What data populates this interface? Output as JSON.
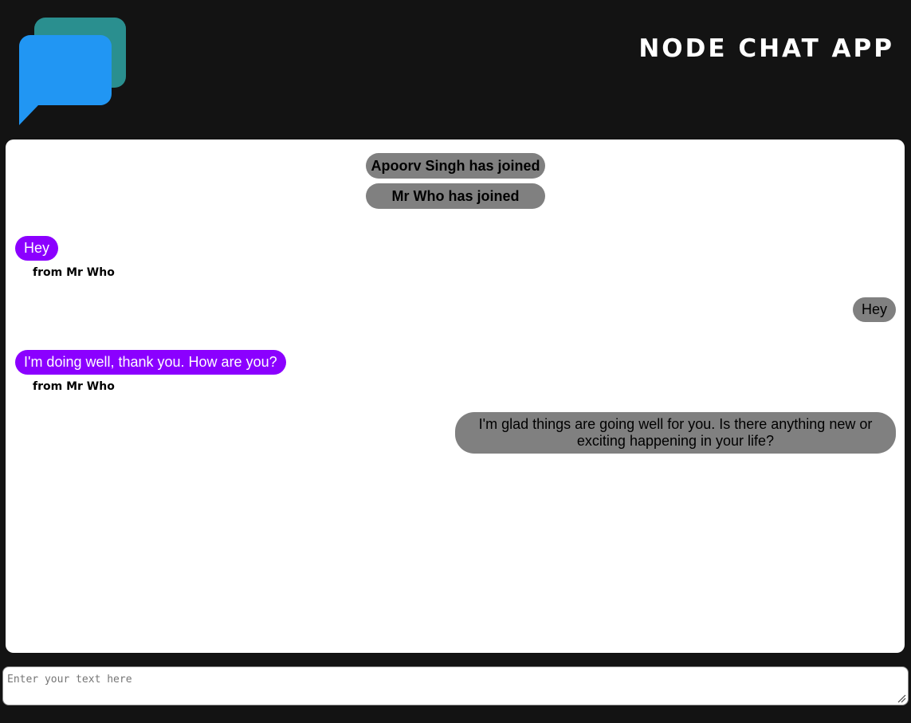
{
  "header": {
    "title": "NODE CHAT APP",
    "logo_icon": "chat-bubbles-icon",
    "logo_colors": {
      "back": "#2a8f8f",
      "front": "#2196f3"
    }
  },
  "chat": {
    "notices": [
      {
        "text": "Apoorv Singh has joined"
      },
      {
        "text": "Mr Who has joined"
      }
    ],
    "messages": [
      {
        "direction": "incoming",
        "text": "Hey",
        "sender": "from Mr Who"
      },
      {
        "direction": "outgoing",
        "text": "Hey"
      },
      {
        "direction": "incoming",
        "text": "I'm doing well, thank you. How are you?",
        "sender": "from Mr Who"
      },
      {
        "direction": "outgoing",
        "text": "I'm glad things are going well for you. Is there anything new or exciting happening in your life?"
      }
    ],
    "colors": {
      "incoming": "#8b00ff",
      "outgoing": "#808080"
    }
  },
  "composer": {
    "placeholder": "Enter your text here",
    "value": ""
  }
}
